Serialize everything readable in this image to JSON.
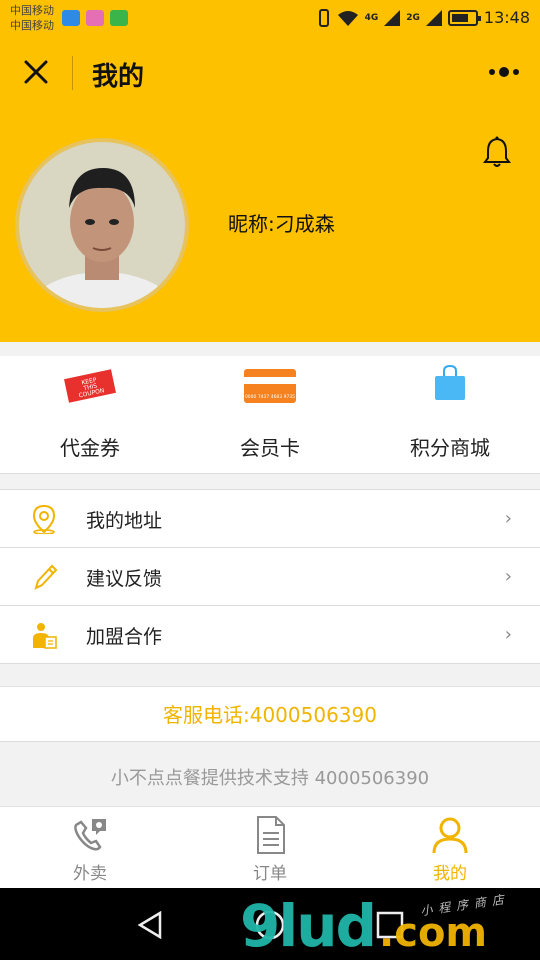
{
  "status_bar": {
    "carrier_1": "中国移动",
    "carrier_2": "中国移动",
    "net_1": "4G",
    "net_2": "2G",
    "time": "13:48"
  },
  "header": {
    "title": "我的",
    "close_icon": "close-icon",
    "more_icon": "more-icon"
  },
  "profile": {
    "nickname": "昵称:刁成森",
    "bell_icon": "bell-icon"
  },
  "shortcuts": [
    {
      "label": "代金券",
      "icon": "coupon-icon",
      "icon_text_1": "KEEP",
      "icon_text_2": "THIS",
      "icon_text_3": "COUPON"
    },
    {
      "label": "会员卡",
      "icon": "membership-card-icon",
      "icon_text": "0000 7437 4683 9735"
    },
    {
      "label": "积分商城",
      "icon": "shopping-bag-icon"
    }
  ],
  "menu": [
    {
      "label": "我的地址",
      "icon": "location-pin-icon",
      "chevron": "›"
    },
    {
      "label": "建议反馈",
      "icon": "pencil-icon",
      "chevron": "›"
    },
    {
      "label": "加盟合作",
      "icon": "partner-icon",
      "chevron": "›"
    }
  ],
  "hotline": "客服电话:4000506390",
  "support": "小不点点餐提供技术支持 4000506390",
  "tabs": [
    {
      "label": "外卖",
      "icon": "takeout-phone-icon",
      "active": false
    },
    {
      "label": "订单",
      "icon": "order-document-icon",
      "active": false
    },
    {
      "label": "我的",
      "icon": "profile-icon",
      "active": true
    }
  ],
  "watermark": {
    "main": "9lud",
    "suffix": ".com",
    "cn": "小程序商店"
  },
  "colors": {
    "accent": "#fdc100",
    "highlight_text": "#f1b400",
    "page_bg": "#f2f2f2"
  }
}
